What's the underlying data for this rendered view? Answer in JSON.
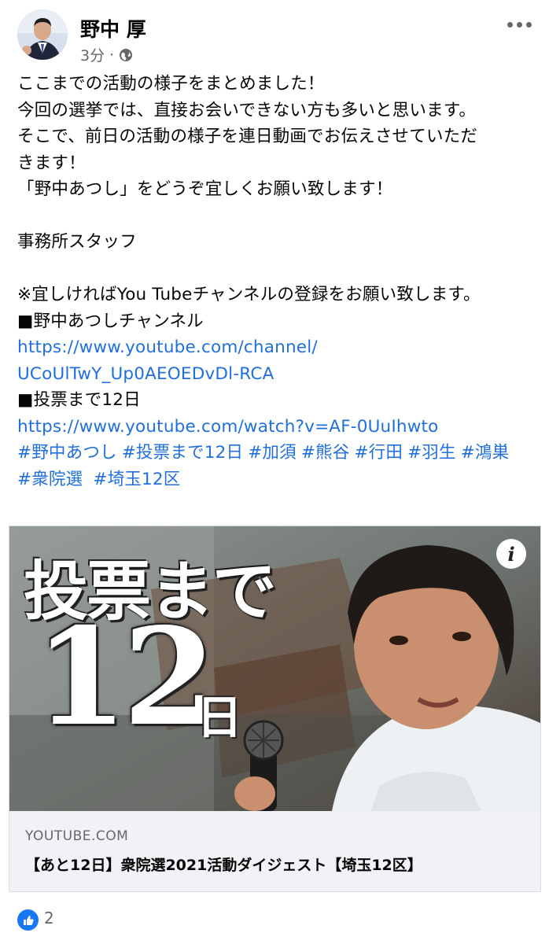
{
  "post": {
    "author": "野中 厚",
    "time": "3分",
    "separator": "·",
    "lines": [
      "ここまでの活動の様子をまとめました！",
      "今回の選挙では、直接お会いできない方も多いと思います。",
      "そこで、前日の活動の様子を連日動画でお伝えさせていただ",
      "きます！",
      "「野中あつし」をどうぞ宜しくお願い致します！",
      "",
      "事務所スタッフ",
      "",
      "※宜しければYou Tubeチャンネルの登録をお願い致します。",
      "■野中あつしチャンネル"
    ],
    "channel_link_line1": "https://www.youtube.com/channel/",
    "channel_link_line2": "UCoUlTwY_Up0AEOEDvDl-RCA",
    "vote_heading": "■投票まで12日",
    "video_link": "https://www.youtube.com/watch?v=AF-0UuIhwto",
    "hashtags_line1": [
      "#野中あつし",
      "#投票まで12日",
      "#加須",
      "#熊谷",
      "#行田",
      "#羽生",
      "#鴻巣"
    ],
    "hashtags_line2": [
      "#衆院選",
      " #埼玉12区"
    ]
  },
  "link_card": {
    "thumb_text_line1": "投票まで",
    "thumb_text_number": "12",
    "thumb_text_unit": "日",
    "info_icon_text": "i",
    "domain": "YOUTUBE.COM",
    "title": "【あと12日】衆院選2021活動ダイジェスト【埼玉12区】"
  },
  "reactions": {
    "like_count": "2"
  },
  "colors": {
    "link": "#216fdb",
    "like_blue": "#1877f2",
    "meta_gray": "#65676b"
  }
}
